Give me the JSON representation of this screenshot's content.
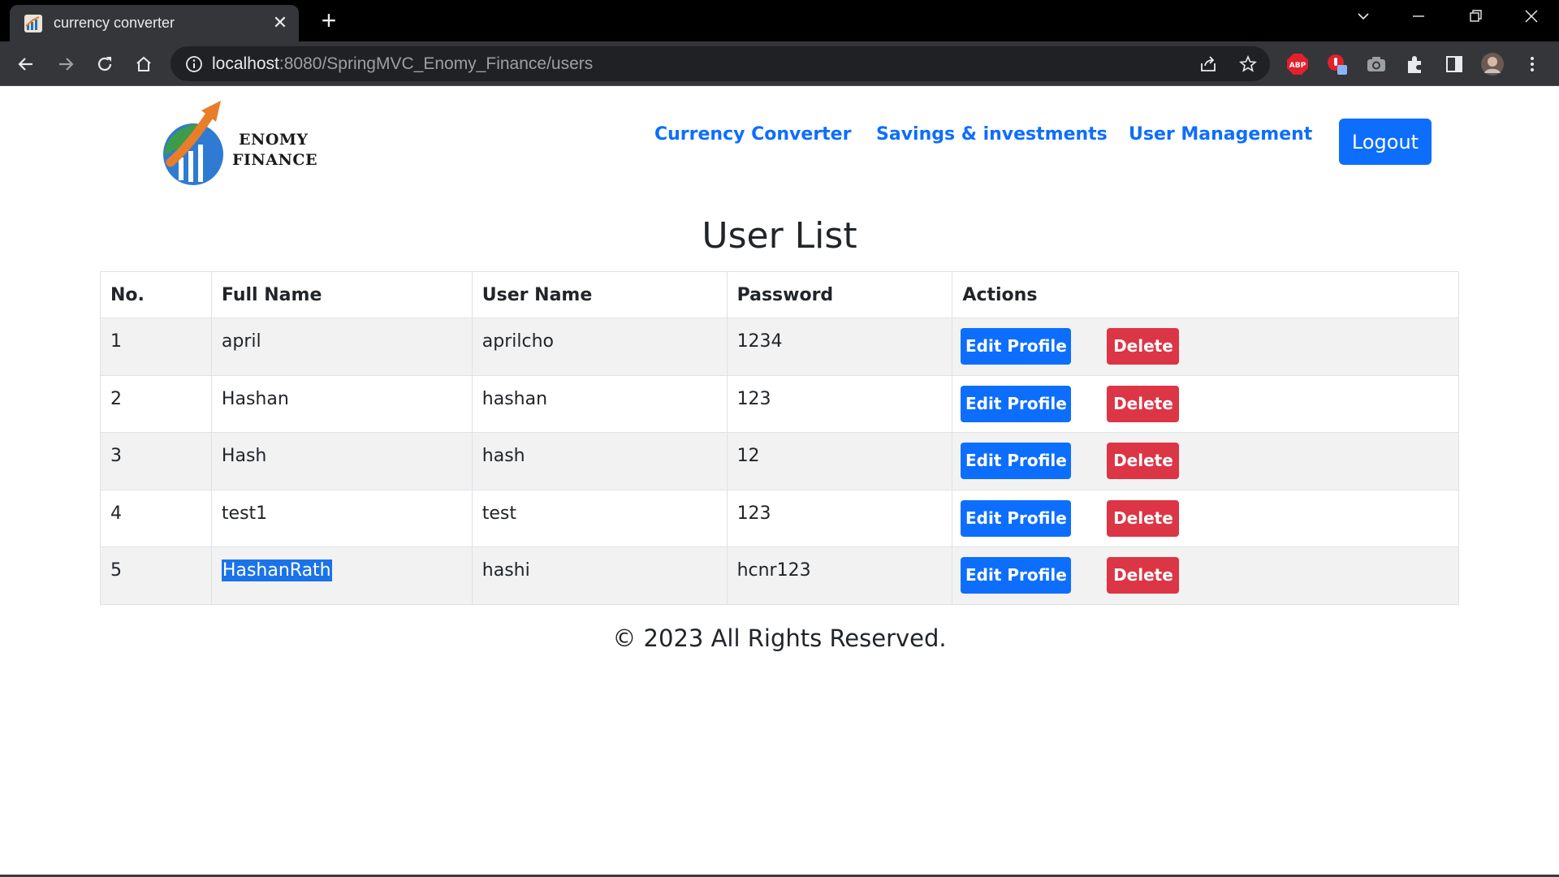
{
  "browser": {
    "tab_title": "currency converter",
    "tab_close_symbol": "✕",
    "new_tab_symbol": "+",
    "url_host": "localhost",
    "url_rest": ":8080/SpringMVC_Enomy_Finance/users",
    "extensions": [
      {
        "name": "adblock-plus",
        "label": "ABP",
        "color": "#e3202b"
      },
      {
        "name": "red-extension",
        "color": "#e3202b"
      },
      {
        "name": "screenshot-extension",
        "color": "#9aa0a6"
      }
    ]
  },
  "header": {
    "logo_line1": "ENOMY",
    "logo_line2": "FINANCE",
    "nav": [
      {
        "label": "Currency Converter"
      },
      {
        "label": "Savings & investments"
      },
      {
        "label": "User Management"
      }
    ],
    "logout_label": "Logout"
  },
  "main": {
    "title": "User List",
    "columns": [
      "No.",
      "Full Name",
      "User Name",
      "Password",
      "Actions"
    ],
    "rows": [
      {
        "no": "1",
        "full_name": "april",
        "user_name": "aprilcho",
        "password": "1234"
      },
      {
        "no": "2",
        "full_name": "Hashan",
        "user_name": "hashan",
        "password": "123"
      },
      {
        "no": "3",
        "full_name": "Hash",
        "user_name": "hash",
        "password": "12"
      },
      {
        "no": "4",
        "full_name": "test1",
        "user_name": "test",
        "password": "123"
      },
      {
        "no": "5",
        "full_name": "HashanRath",
        "user_name": "hashi",
        "password": "hcnr123"
      }
    ],
    "edit_label": "Edit Profile",
    "delete_label": "Delete"
  },
  "footer": {
    "text": "© 2023 All Rights Reserved."
  },
  "colors": {
    "primary": "#0d6efd",
    "danger": "#dc3545",
    "selection": "#1a73e8"
  }
}
